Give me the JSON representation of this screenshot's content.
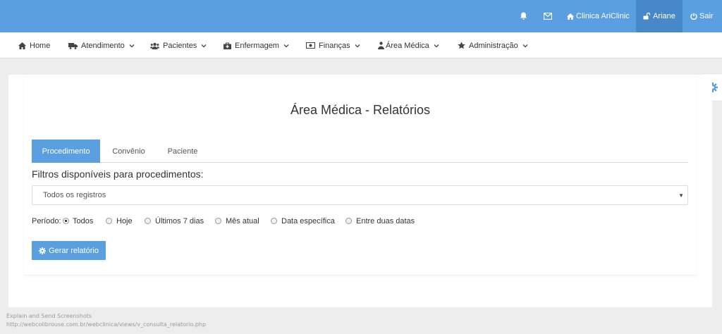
{
  "topbar": {
    "clinic_label": "Clinica AriClinic",
    "user_label": "Ariane",
    "logout_label": "Sair"
  },
  "nav": {
    "items": [
      {
        "label": "Home",
        "icon": "home-icon"
      },
      {
        "label": "Atendimento",
        "icon": "ambulance-icon"
      },
      {
        "label": "Pacientes",
        "icon": "users-icon"
      },
      {
        "label": "Enfermagem",
        "icon": "medkit-icon"
      },
      {
        "label": "Finanças",
        "icon": "money-icon"
      },
      {
        "label": "Área Médica",
        "icon": "user-md-icon"
      },
      {
        "label": "Administração",
        "icon": "star-icon"
      }
    ]
  },
  "main": {
    "title": "Área Médica - Relatórios",
    "tabs": [
      {
        "label": "Procedimento",
        "active": true
      },
      {
        "label": "Convênio",
        "active": false
      },
      {
        "label": "Paciente",
        "active": false
      }
    ],
    "filters_label": "Filtros disponíveis para procedimentos:",
    "select_value": "Todos os registros",
    "periodo_label": "Período:",
    "periodo_options": [
      {
        "label": "Todos",
        "checked": true
      },
      {
        "label": "Hoje",
        "checked": false
      },
      {
        "label": "Últimos 7 dias",
        "checked": false
      },
      {
        "label": "Mês atual",
        "checked": false
      },
      {
        "label": "Data específica",
        "checked": false
      },
      {
        "label": "Entre duas datas",
        "checked": false
      }
    ],
    "generate_button": "Gerar relatório"
  },
  "status": {
    "line1": "Explain and Send Screenshots",
    "line2": "http://webcolibrouse.com.br/webclinica/views/v_consulta_relatorio.php"
  },
  "colors": {
    "primary": "#5a9fe0",
    "primary_dark": "#4688c8"
  }
}
